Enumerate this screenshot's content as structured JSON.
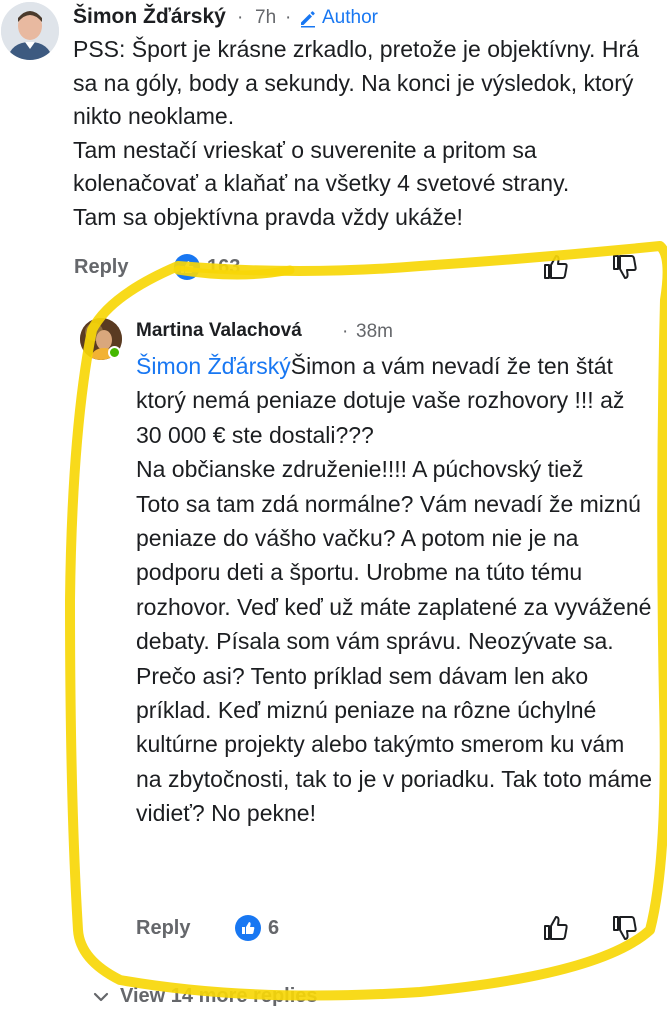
{
  "comment": {
    "author": "Šimon Žďárský",
    "time": "7h",
    "separator": "·",
    "author_badge": "Author",
    "text": "PSS: Šport je krásne zrkadlo, pretože je objektívny. Hrá sa na góly, body a sekundy. Na konci je výsledok, ktorý nikto neoklame.\nTam nestačí vrieskať o suverenite a pritom sa kolenačovať a klaňať na všetky 4 svetové strany.\nTam sa objektívna pravda vždy ukáže!",
    "reply_label": "Reply",
    "like_count": "163"
  },
  "reply": {
    "author": "Martina Valachová",
    "time": "38m",
    "separator": "·",
    "mention": "Šimon Žďárský",
    "text": "Šimon a vám nevadí že ten štát ktorý nemá peniaze dotuje vaše rozhovory  !!! až 30 000 € ste dostali???\nNa občianske združenie!!!! A púchovský tiež\nToto sa tam zdá normálne? Vám nevadí že miznú peniaze do vášho vačku? A potom nie je na podporu deti a športu. Urobme na túto tému rozhovor. Veď keď už máte zaplatené za vyvážené debaty. Písala som vám správu. Neozývate sa. Prečo asi? Tento príklad sem dávam len ako príklad. Keď miznú peniaze na rôzne úchylné kultúrne projekty alebo takýmto smerom ku vám na zbytočnosti, tak to je v poriadku. Tak toto máme vidieť? No pekne!",
    "reply_label": "Reply",
    "like_count": "6"
  },
  "view_more_label": "View 14 more replies",
  "icons": {
    "edit": "pencil-icon",
    "like_badge": "thumbs-up-icon",
    "like": "thumbs-up-outline-icon",
    "dislike": "thumbs-down-outline-icon",
    "expand": "chevron-down-icon"
  },
  "colors": {
    "link": "#1877f2",
    "meta": "#65676b",
    "highlight": "#f7d708",
    "online": "#44b700"
  }
}
